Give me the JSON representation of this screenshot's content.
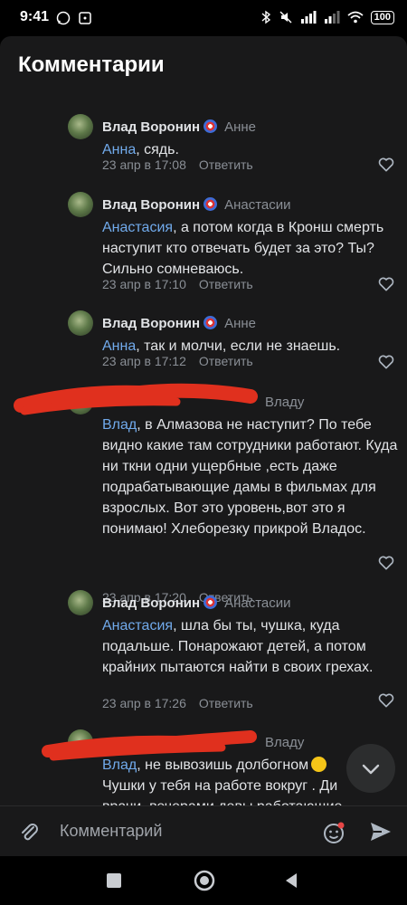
{
  "status": {
    "time": "9:41",
    "battery": "100"
  },
  "header": {
    "title": "Комментарии"
  },
  "comments": [
    {
      "author": "Влад Воронин",
      "reply_to": "Анне",
      "mention": "Анна",
      "text": ", сядь.",
      "time": "23 апр в 17:08",
      "reply_label": "Ответить"
    },
    {
      "author": "Влад Воронин",
      "reply_to": "Анастасии",
      "mention": "Анастасия",
      "text": ", а потом когда в Кронш смерть наступит кто отвечать будет за это? Ты? Сильно сомневаюсь.",
      "time": "23 апр в 17:10",
      "reply_label": "Ответить"
    },
    {
      "author": "Влад Воронин",
      "reply_to": "Анне",
      "mention": "Анна",
      "text": ", так и молчи, если не знаешь.",
      "time": "23 апр в 17:12",
      "reply_label": "Ответить"
    },
    {
      "author": "",
      "reply_to": "Владу",
      "mention": "Влад",
      "text": ", в Алмазова не наступит? По тебе видно какие там сотрудники работают. Куда ни ткни одни ущербные ,есть даже подрабатывающие дамы в фильмах для взрослых. Вот это уровень,вот это я понимаю! Хлеборезку прикрой Владос.",
      "time": "23 апр в 17:20",
      "reply_label": "Ответить"
    },
    {
      "author": "Влад Воронин",
      "reply_to": "Анастасии",
      "mention": "Анастасия",
      "text": ", шла бы ты, чушка, куда подальше. Понарожают детей, а потом крайних пытаются найти в своих грехах.",
      "time": "23 апр в 17:26",
      "reply_label": "Ответить"
    },
    {
      "author": "",
      "reply_to": "Владу",
      "mention": "Влад",
      "text": ", не вывозишь долбогном",
      "line2": "Чушки у тебя на работе вокруг . Ди",
      "line3": "врачи, вечерами девы работающие"
    }
  ],
  "input": {
    "placeholder": "Комментарий"
  },
  "icons": {
    "attach": "paperclip-icon",
    "emoji": "emoji-icon",
    "send": "send-icon",
    "scroll": "chevron-down-icon",
    "like": "heart-icon"
  },
  "colors": {
    "background": "#19191a",
    "mention": "#71aaeb",
    "secondary": "#8a8f96",
    "scribble": "#e0301e"
  }
}
